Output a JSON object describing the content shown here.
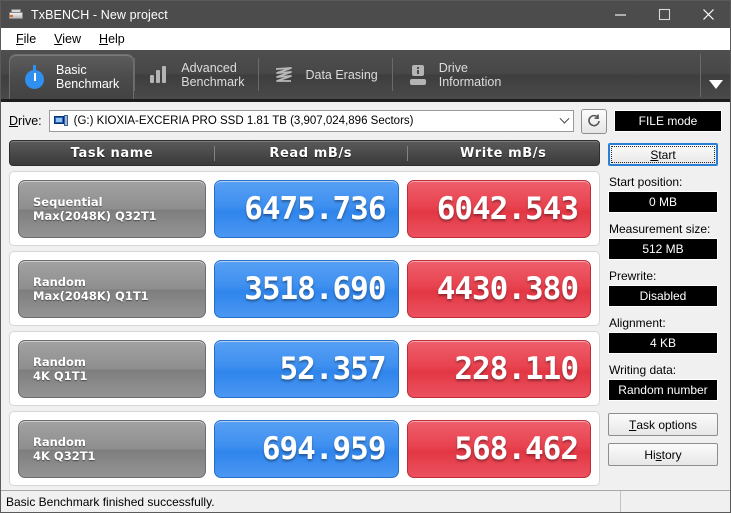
{
  "window": {
    "title": "TxBENCH - New project",
    "app_icon": "drive-icon",
    "minimize_label": "Minimize",
    "maximize_label": "Maximize",
    "close_label": "Close"
  },
  "menu": {
    "items": [
      {
        "label": "File",
        "accel": "F"
      },
      {
        "label": "View",
        "accel": "V"
      },
      {
        "label": "Help",
        "accel": "H"
      }
    ]
  },
  "tabs": [
    {
      "label": "Basic\nBenchmark",
      "icon": "stopwatch-icon",
      "active": true
    },
    {
      "label": "Advanced\nBenchmark",
      "icon": "bar-chart-icon",
      "active": false
    },
    {
      "label": "Data Erasing",
      "icon": "waves-icon",
      "active": false
    },
    {
      "label": "Drive\nInformation",
      "icon": "drive-info-icon",
      "active": false
    }
  ],
  "tab_overflow_icon": "chevron-down-icon",
  "drive": {
    "label": "Drive:",
    "selected": "(G:) KIOXIA-EXCERIA PRO SSD  1.81 TB (3,907,024,896 Sectors)",
    "icon": "network-drive-icon",
    "dropdown_icon": "chevron-down-icon",
    "refresh_icon": "refresh-icon",
    "mode_label": "FILE mode"
  },
  "results": {
    "columns": [
      "Task name",
      "Read mB/s",
      "Write mB/s"
    ],
    "rows": [
      {
        "name_line1": "Sequential",
        "name_line2": "Max(2048K) Q32T1",
        "read": "6475.736",
        "write": "6042.543"
      },
      {
        "name_line1": "Random",
        "name_line2": "Max(2048K) Q1T1",
        "read": "3518.690",
        "write": "4430.380"
      },
      {
        "name_line1": "Random",
        "name_line2": "4K Q1T1",
        "read": "52.357",
        "write": "228.110"
      },
      {
        "name_line1": "Random",
        "name_line2": "4K Q32T1",
        "read": "694.959",
        "write": "568.462"
      }
    ]
  },
  "panel": {
    "start_button": "Start",
    "start_accel": "S",
    "fields": [
      {
        "label": "Start position:",
        "value": "0 MB"
      },
      {
        "label": "Measurement size:",
        "value": "512 MB"
      },
      {
        "label": "Prewrite:",
        "value": "Disabled"
      },
      {
        "label": "Alignment:",
        "value": "4 KB"
      },
      {
        "label": "Writing data:",
        "value": "Random number"
      }
    ],
    "task_options_button": "Task options",
    "task_options_accel": "T",
    "history_button": "History",
    "history_accel": "s"
  },
  "status": {
    "message": "Basic Benchmark finished successfully."
  },
  "colors": {
    "read_accent": "#3d8fef",
    "write_accent": "#e8424f",
    "titlebar": "#4c4c4c",
    "tabstrip": "#474747"
  }
}
